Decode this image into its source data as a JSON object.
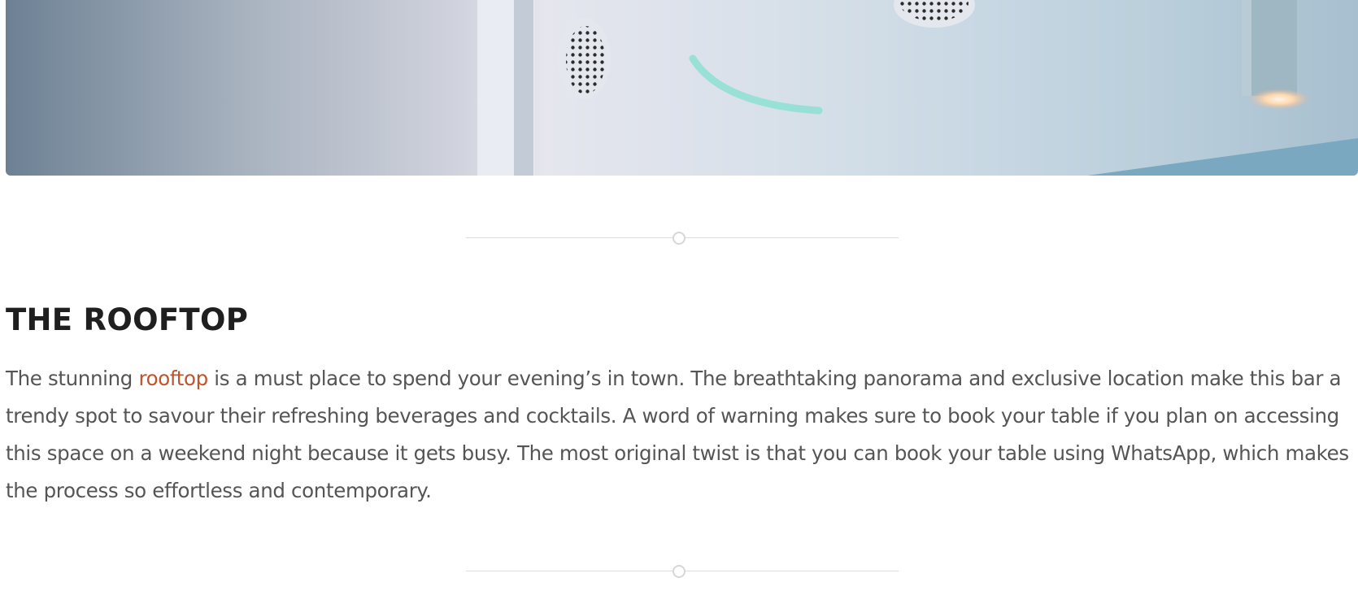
{
  "hero": {
    "alt": "Rooftop bar interior with speakers and pendant light"
  },
  "section": {
    "title": "THE ROOFTOP",
    "paragraph_before_link": "The stunning ",
    "link_text": "rooftop",
    "paragraph_after_link": " is a must place to spend your evening’s in town. The breathtaking panorama and exclusive location make this bar a trendy spot to savour their refreshing beverages and cocktails. A word of warning makes sure to book your table if you plan on accessing this space on a weekend night because it gets busy. The most original twist is that you can book your table using WhatsApp, which makes the process so effortless and contemporary."
  },
  "colors": {
    "link": "#c0532a",
    "heading": "#1f1f1f",
    "body": "#555555",
    "divider": "#dcdcdc"
  }
}
